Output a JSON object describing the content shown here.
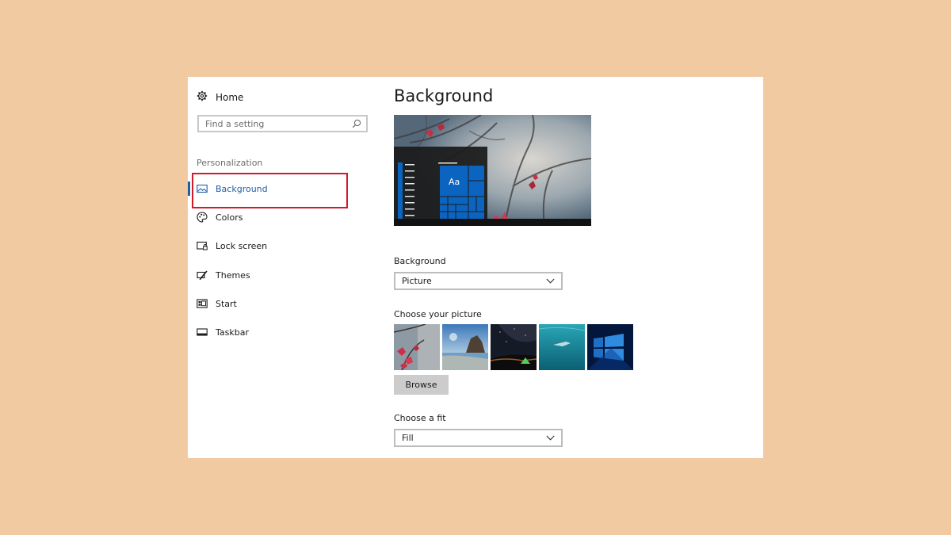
{
  "sidebar": {
    "home_label": "Home",
    "search_placeholder": "Find a setting",
    "section_label": "Personalization",
    "items": [
      {
        "label": "Background",
        "icon": "picture-icon",
        "active": true
      },
      {
        "label": "Colors",
        "icon": "palette-icon"
      },
      {
        "label": "Lock screen",
        "icon": "lock-screen-icon"
      },
      {
        "label": "Themes",
        "icon": "brush-icon"
      },
      {
        "label": "Start",
        "icon": "start-icon"
      },
      {
        "label": "Taskbar",
        "icon": "taskbar-icon"
      }
    ]
  },
  "main": {
    "title": "Background",
    "preview": {
      "tile_text": "Aa"
    },
    "background_label": "Background",
    "background_value": "Picture",
    "choose_picture_label": "Choose your picture",
    "thumbnails": [
      "red-leaves",
      "beach-rocks",
      "night-sky-tent",
      "underwater-swimmer",
      "windows-blue"
    ],
    "browse_label": "Browse",
    "choose_fit_label": "Choose a fit",
    "fit_value": "Fill"
  },
  "colors": {
    "accent": "#1f5fa8",
    "highlight_border": "#d11a2a",
    "page_background": "#f2caa2",
    "tile_blue": "#0a64c0"
  }
}
